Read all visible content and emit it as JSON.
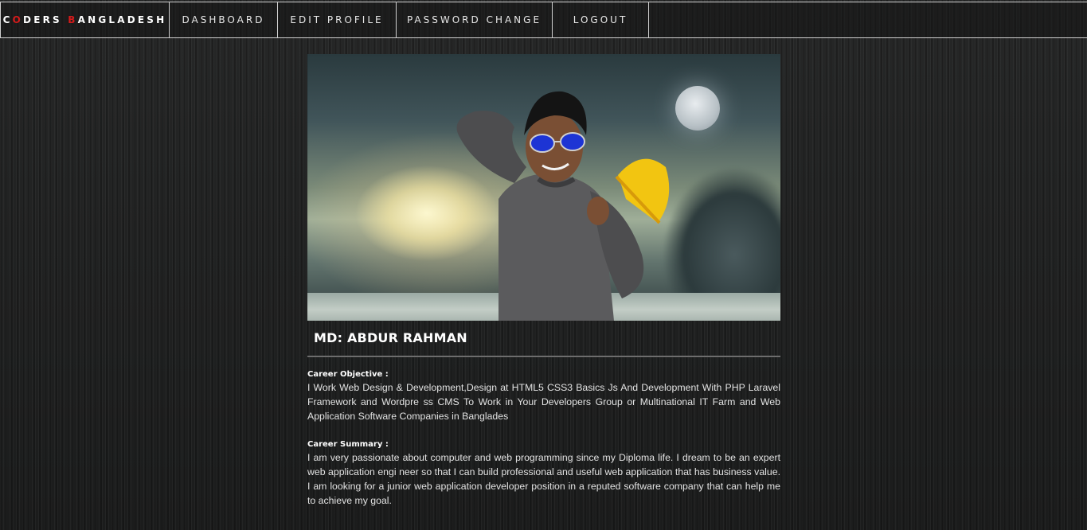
{
  "navbar": {
    "brand": {
      "letter_1": "C",
      "accent_1": "O",
      "rest_1": "DERS ",
      "accent_2": "B",
      "rest_2": "ANGLADESH"
    },
    "items": [
      {
        "label": "DASHBOARD"
      },
      {
        "label": "EDIT PROFILE"
      },
      {
        "label": "PASSWORD CHANGE"
      },
      {
        "label": "LOGOUT"
      }
    ]
  },
  "profile": {
    "name": "MD: ABDUR RAHMAN",
    "career_objective": {
      "title": "Career Objective :",
      "body": "I Work Web Design & Development,Design at HTML5 CSS3 Basics Js And Development With PHP Laravel Framework and Wordpre ss CMS To Work in Your Developers Group or Multinational IT Farm and Web Application Software Companies in Banglades"
    },
    "career_summary": {
      "title": "Career Summary :",
      "body": "I am very passionate about computer and web programming since my Diploma life. I dream to be an expert web application engi neer so that I can build professional and useful web application that has business value. I am looking for a junior web application developer position in a reputed software company that can help me to achieve my goal."
    }
  },
  "colors": {
    "brand_accent": "#d31b1b",
    "background": "#1f2020",
    "nav_border": "#cfcfcf",
    "text": "#e2e2e2"
  }
}
